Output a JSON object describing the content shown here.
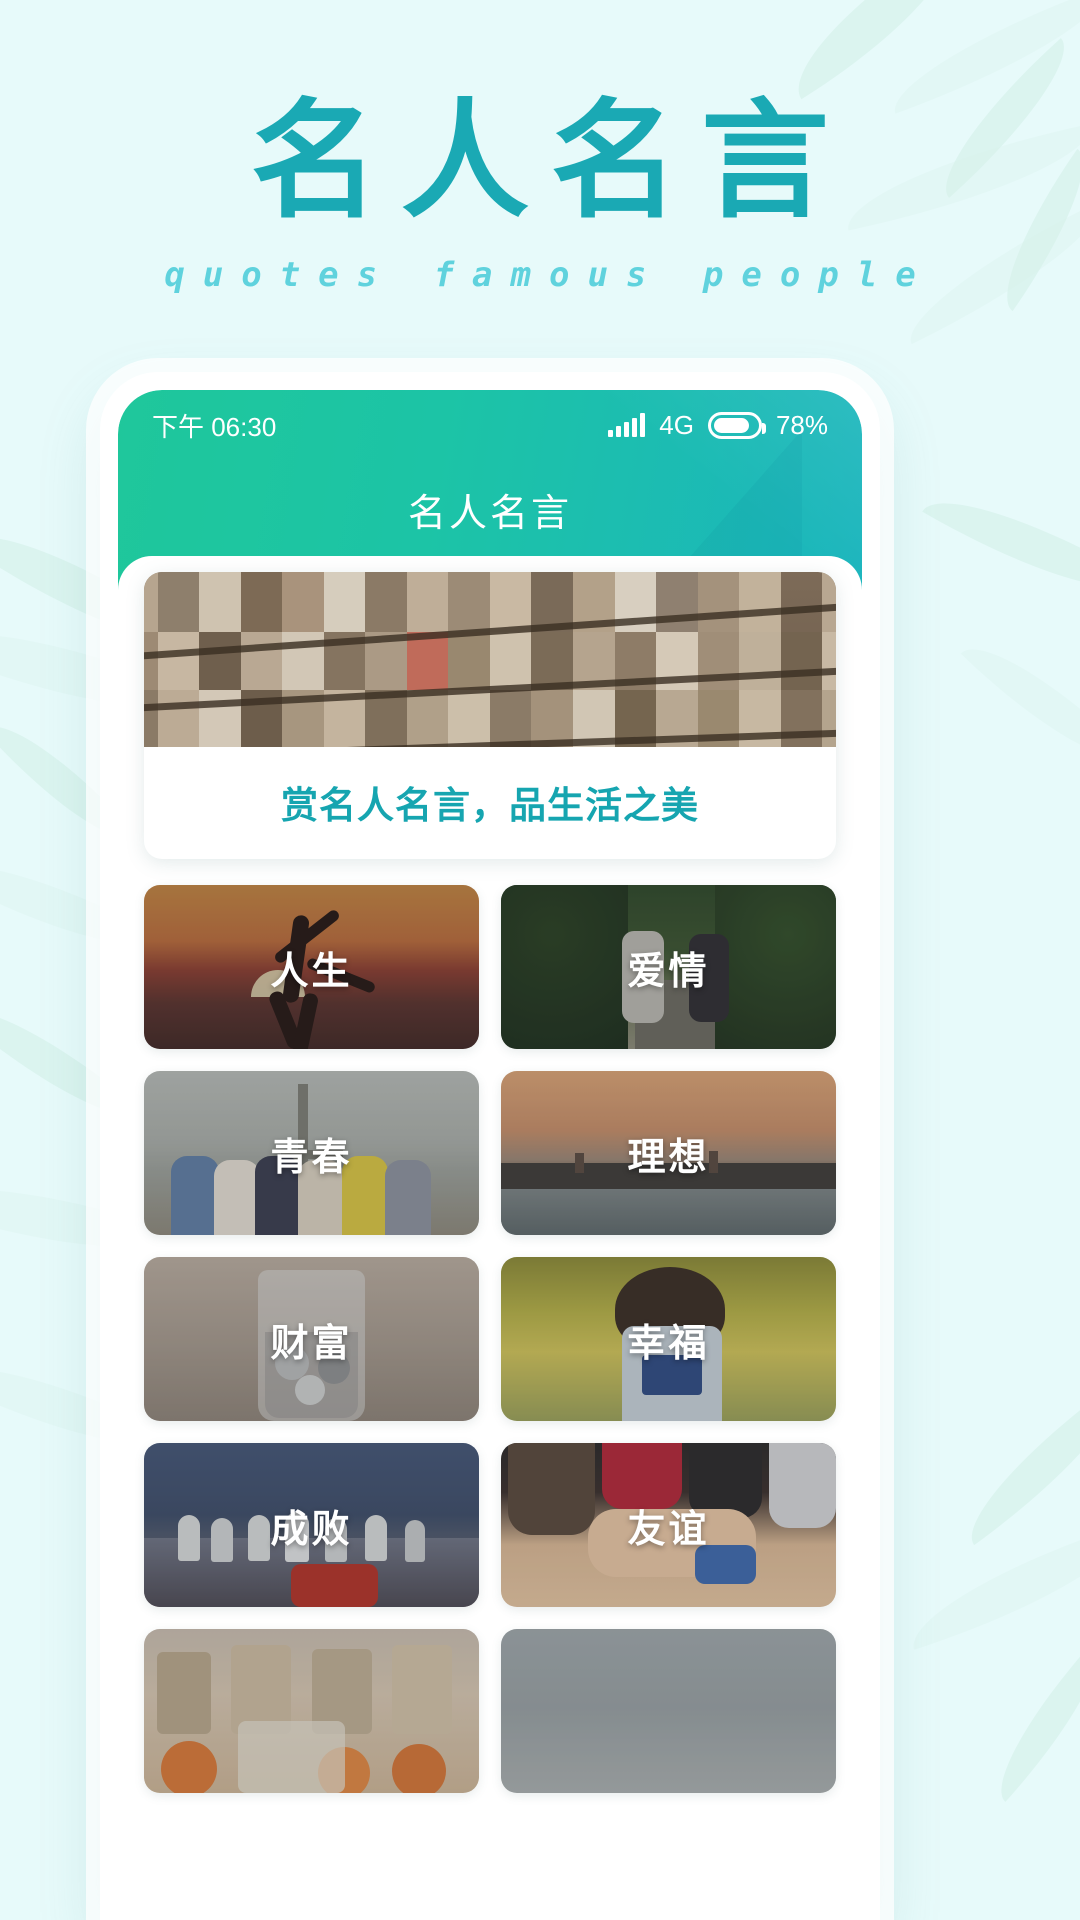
{
  "hero": {
    "title": "名人名言",
    "subtitle": "quotes famous people",
    "title_color": "#1aa9b4",
    "subtitle_color": "#5fd2dd",
    "background_color": "#e7fafa"
  },
  "phone": {
    "status_bar": {
      "time": "下午 06:30",
      "network": "4G",
      "battery_percent": "78%",
      "signal_icon": "signal-bars-icon",
      "battery_icon": "battery-icon"
    },
    "app_header": {
      "title": "名人名言",
      "gradient_from": "#1fc79b",
      "gradient_to": "#1bb5bd"
    },
    "banner": {
      "image_alt": "library-bookshelves",
      "caption": "赏名人名言，品生活之美",
      "caption_color": "#16a5b0"
    },
    "categories": [
      {
        "label": "人生",
        "art": "sunset-silhouette"
      },
      {
        "label": "爱情",
        "art": "couple-tree-road"
      },
      {
        "label": "青春",
        "art": "friends-arms-beach"
      },
      {
        "label": "理想",
        "art": "ocean-sunset-boats"
      },
      {
        "label": "财富",
        "art": "coin-jar"
      },
      {
        "label": "幸福",
        "art": "child-water-splash"
      },
      {
        "label": "成败",
        "art": "chess-board"
      },
      {
        "label": "友谊",
        "art": "hands-together"
      },
      {
        "label": "",
        "art": "kitchen-fruit"
      },
      {
        "label": "",
        "art": "grey-scene"
      }
    ]
  }
}
